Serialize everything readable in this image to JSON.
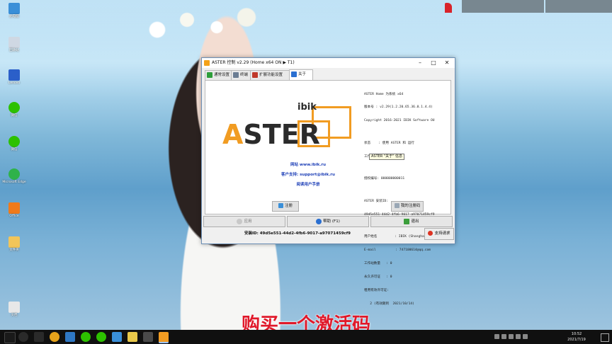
{
  "colors": {
    "accent": "#f19c22",
    "link": "#1d3fb7",
    "subtitle": "#e0192a"
  },
  "desktop_icons": [
    {
      "label": "此电脑",
      "icon": "computer-icon"
    },
    {
      "label": "回收站",
      "icon": "recycle-bin-icon"
    },
    {
      "label": "Lenovo",
      "icon": "app-icon"
    },
    {
      "label": "微信",
      "icon": "wechat-icon"
    },
    {
      "label": "微信",
      "icon": "wechat-icon"
    },
    {
      "label": "Microsoft Edge",
      "icon": "edge-icon"
    },
    {
      "label": "Office",
      "icon": "office-icon"
    },
    {
      "label": "文件夹",
      "icon": "folder-icon"
    },
    {
      "label": "文档",
      "icon": "document-icon"
    }
  ],
  "widgets": {
    "left": "",
    "right": ""
  },
  "window": {
    "title": "ASTER 控制 v2.29 (Home x64 ON ▶ T1)",
    "tabs": [
      {
        "label": "通常设置",
        "icon": "settings-icon"
      },
      {
        "label": "终端",
        "icon": "terminal-icon"
      },
      {
        "label": "扩展功能设置",
        "icon": "tools-icon"
      },
      {
        "label": "关于",
        "icon": "info-icon"
      }
    ],
    "logo": {
      "brand_small": "ibik",
      "brand_first": "A",
      "brand_rest": "STER"
    },
    "links": {
      "website": "网站 www.ibik.ru",
      "support": "客户支持: support@ibik.ru",
      "manual": "阅读用户手册"
    },
    "info_lines": [
      "ASTER Home 为系统 x64",
      "版本号 : v2.29(1.2.20.65.36.0.1.4.4)",
      "Copyright 2016-2021 IBIK Software OU",
      "",
      "状态    : 使用 ASTER 和 运行",
      "工作站: 1",
      "",
      "授权编号: 000000000011",
      "",
      "ASTER 安装ID:",
      "49d5e551-44d2-4fb6-9017-a97071459cf9",
      "",
      "用户姓名         : IBIK (Shanghai)",
      "E-mail          : 747100614@qq.com",
      "工作站数量   : 0",
      "永久许可证   : 0",
      "租用有效许可证:",
      "   2 (有效期到  2021/10/14)"
    ],
    "tooltip": "ASTER \"关于\" 信息",
    "register_button": "注册",
    "my_code_button": "我的注册码",
    "apply_button": "应用",
    "help_button": "帮助 (F1)",
    "exit_button": "退出",
    "install_id": "安装ID: 49d5e551-44d2-4fb6-9017-a97071459cf9",
    "support_button": "支持请求"
  },
  "subtitle": "购买一个激活码",
  "taskbar": {
    "time": "10:52",
    "date": "2021/7/19"
  }
}
